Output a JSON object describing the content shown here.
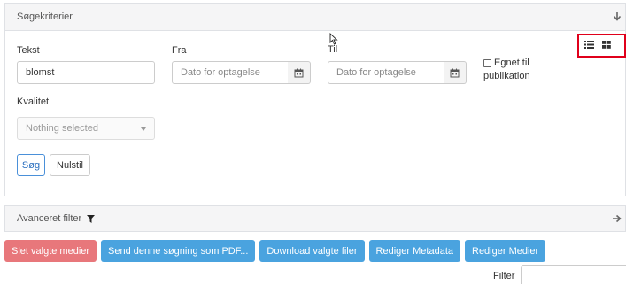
{
  "criteria": {
    "title": "Søgekriterier",
    "tekst_label": "Tekst",
    "tekst_value": "blomst",
    "fra_label": "Fra",
    "fra_placeholder": "Dato for optagelse",
    "til_label": "Til",
    "til_placeholder": "Dato for optagelse",
    "egnet_line1": "Egnet til",
    "egnet_line2": "publikation",
    "kvalitet_label": "Kvalitet",
    "kvalitet_value": "Nothing selected",
    "search_button": "Søg",
    "reset_button": "Nulstil"
  },
  "advanced": {
    "title": "Avanceret filter"
  },
  "actions": {
    "delete": "Slet valgte medier",
    "send_pdf": "Send denne søgning som PDF...",
    "download": "Download valgte filer",
    "edit_metadata": "Rediger Metadata",
    "edit_media": "Rediger Medier"
  },
  "filter": {
    "label": "Filter"
  },
  "icons": {
    "expand": "arrow-down-icon",
    "collapse": "arrow-right-icon",
    "list_view": "list-view-icon",
    "grid_view": "grid-view-icon",
    "calendar": "calendar-icon",
    "funnel": "filter-funnel-icon"
  },
  "colors": {
    "danger": "#e8777b",
    "info": "#4aa3df",
    "highlight": "#e0001b"
  }
}
